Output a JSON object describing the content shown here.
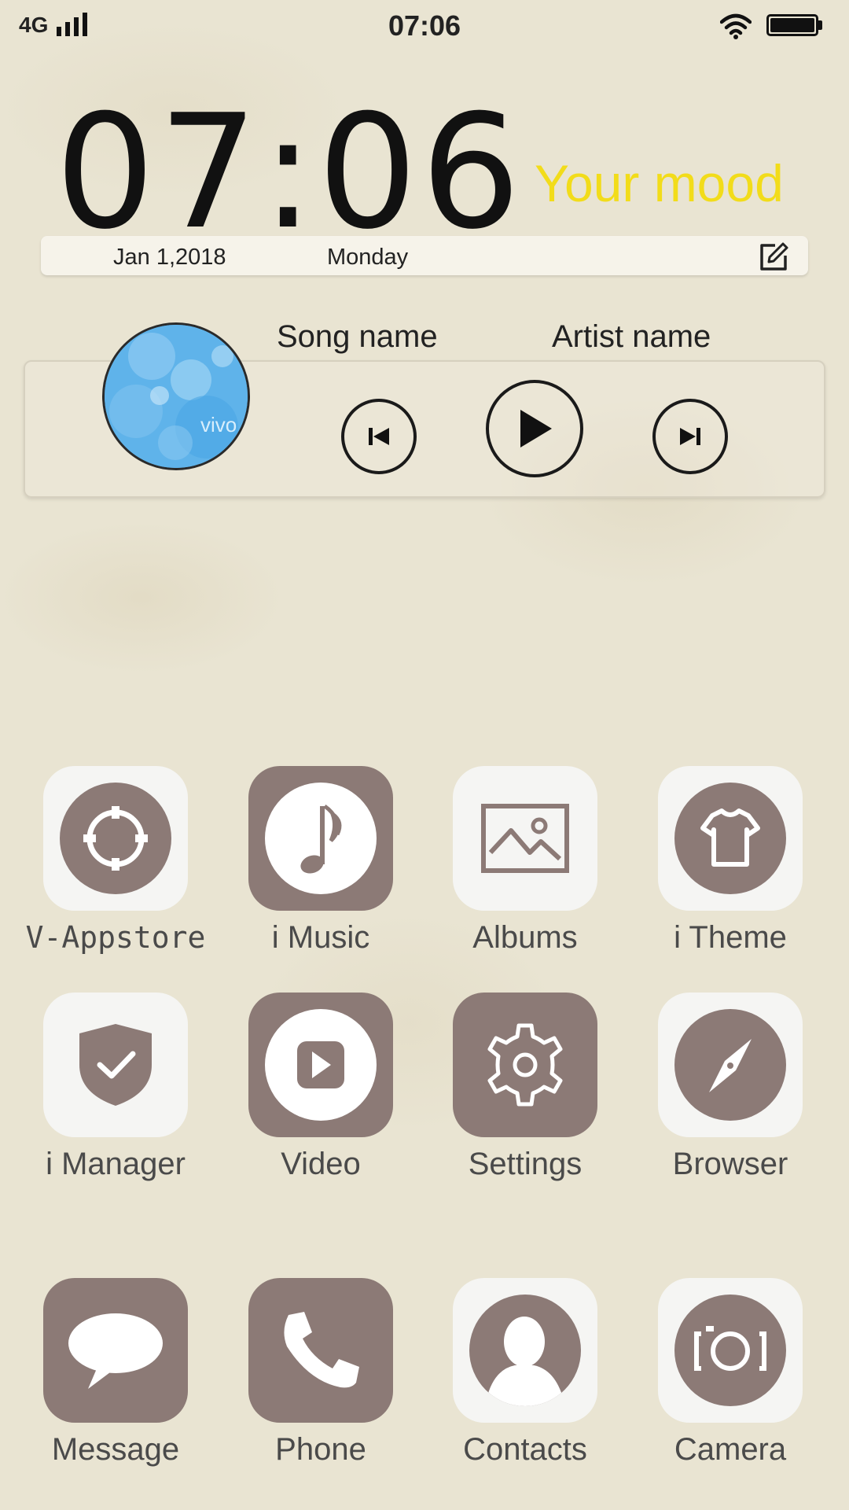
{
  "status_bar": {
    "network": "4G",
    "time": "07:06"
  },
  "clock_widget": {
    "time": "07:06",
    "mood": "Your mood",
    "date": "Jan 1,2018",
    "day": "Monday",
    "mood_color": "#f2dc1a"
  },
  "music_widget": {
    "song": "Song name",
    "artist": "Artist name",
    "album_art_text": "vivo"
  },
  "apps": [
    {
      "label": "V-Appstore",
      "icon": "target-icon"
    },
    {
      "label": "i Music",
      "icon": "music-note-icon"
    },
    {
      "label": "Albums",
      "icon": "image-icon"
    },
    {
      "label": "i Theme",
      "icon": "tshirt-icon"
    },
    {
      "label": "i Manager",
      "icon": "shield-check-icon"
    },
    {
      "label": "Video",
      "icon": "play-icon"
    },
    {
      "label": "Settings",
      "icon": "gear-icon"
    },
    {
      "label": "Browser",
      "icon": "compass-icon"
    },
    {
      "label": "Message",
      "icon": "chat-bubble-icon"
    },
    {
      "label": "Phone",
      "icon": "phone-icon"
    },
    {
      "label": "Contacts",
      "icon": "person-icon"
    },
    {
      "label": "Camera",
      "icon": "camera-icon"
    }
  ],
  "colors": {
    "background": "#e9e4d2",
    "icon_mauve": "#8c7a76",
    "tile_white": "#f5f5f3"
  }
}
